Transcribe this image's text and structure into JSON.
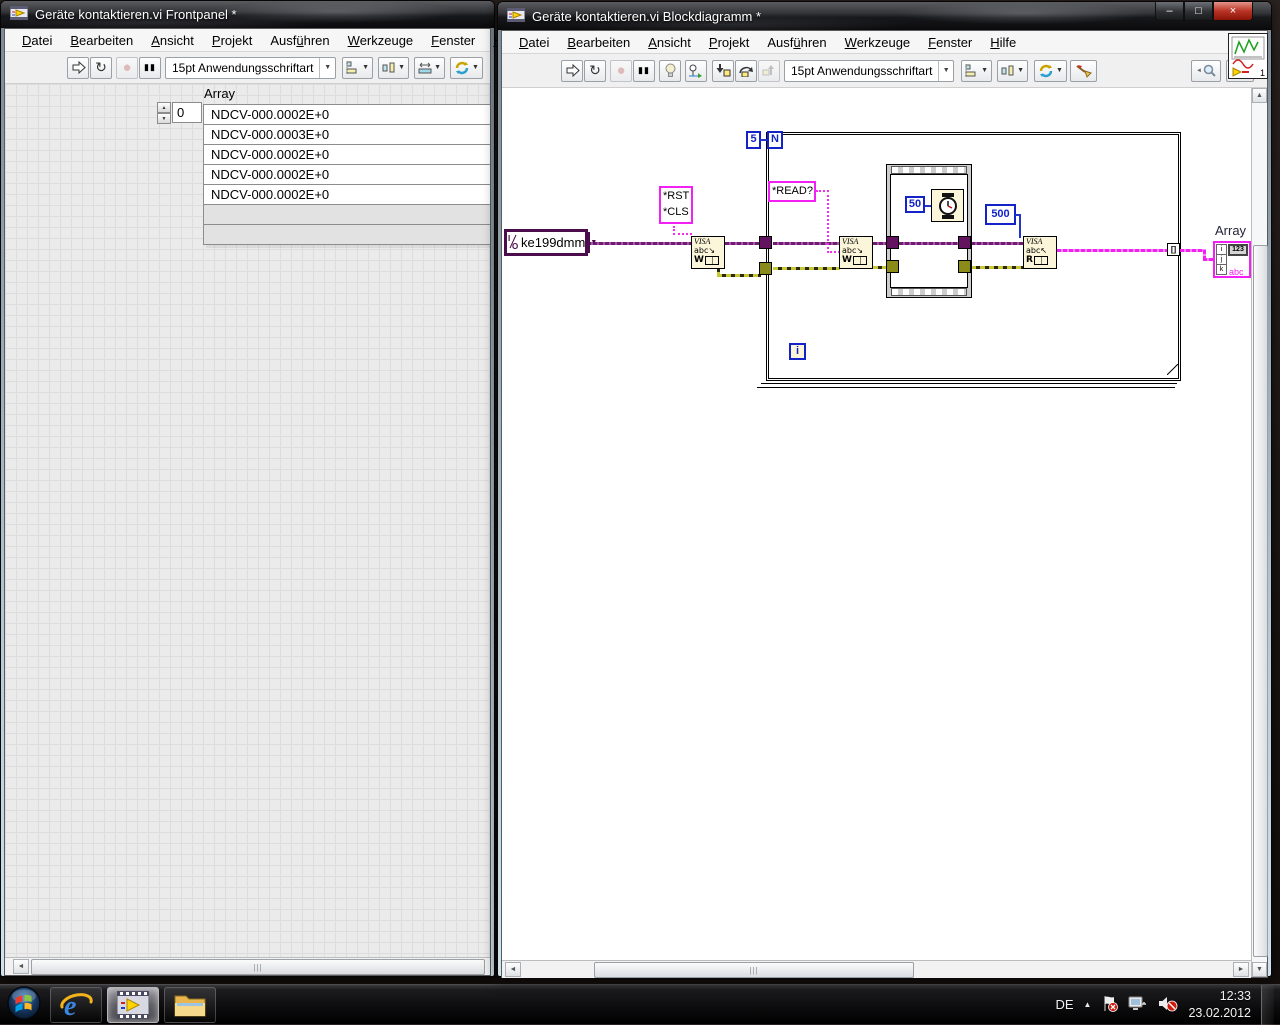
{
  "menu_items": [
    {
      "label": "Datei"
    },
    {
      "label": "Bearbeiten"
    },
    {
      "label": "Ansicht"
    },
    {
      "label": "Projekt"
    },
    {
      "label": "Ausführen"
    },
    {
      "label": "Werkzeuge"
    },
    {
      "label": "Fenster"
    },
    {
      "label": "Hilfe"
    }
  ],
  "front_panel": {
    "title": "Geräte kontaktieren.vi Frontpanel *",
    "font_selector": "15pt Anwendungsschriftart",
    "array": {
      "label": "Array",
      "index": "0",
      "values": [
        "NDCV-000.0002E+0",
        "NDCV-000.0003E+0",
        "NDCV-000.0002E+0",
        "NDCV-000.0002E+0",
        "NDCV-000.0002E+0"
      ]
    }
  },
  "block_diagram": {
    "title": "Geräte kontaktieren.vi Blockdiagramm *",
    "font_selector": "15pt Anwendungsschriftart",
    "vi_badge": "1",
    "diagram": {
      "visa_resource": "ke199dmm",
      "init_cmd_line1": "*RST",
      "init_cmd_line2": "*CLS",
      "read_cmd": "*READ?",
      "loop_count": "5",
      "count_terminal": "N",
      "iteration_terminal": "i",
      "wait_ms": "50",
      "byte_count": "500",
      "visa_label": "VISA",
      "abc_write": "abc↘",
      "abc_read": "abc↖",
      "write_letter": "W",
      "read_letter": "R",
      "array_label": "Array",
      "index_tunnel": "[]"
    }
  },
  "taskbar": {
    "language": "DE",
    "time": "12:33",
    "date": "23.02.2012"
  },
  "window_buttons": {
    "minimize": "–",
    "maximize": "□",
    "close": "×"
  },
  "icons": {
    "dropdown": "▼",
    "up": "▲",
    "down": "▼",
    "left": "◄",
    "right": "►",
    "pause": "▮▮",
    "abort": "●",
    "run_cont": "↻",
    "help": "?",
    "grip": "|||",
    "hidden_icons": "▲"
  }
}
